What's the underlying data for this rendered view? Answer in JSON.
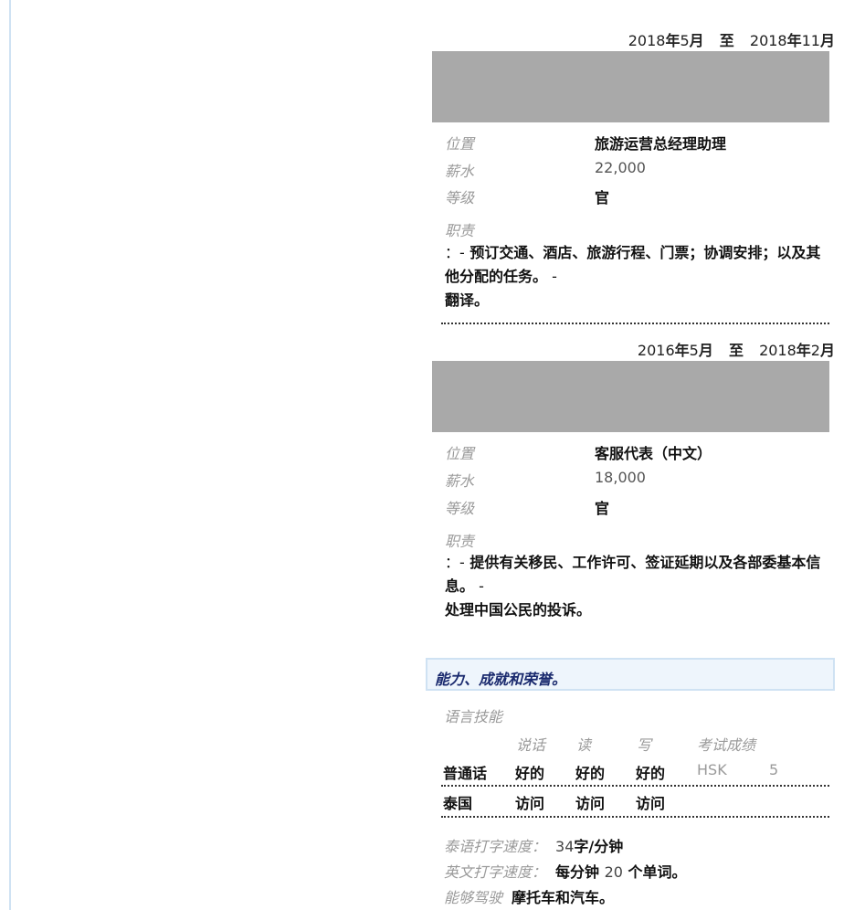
{
  "jobs": [
    {
      "date": {
        "start_year": "2018",
        "start_month": "5",
        "sep": "至",
        "end_year": "2018",
        "end_month": "11",
        "year_char": "年",
        "month_char": "月"
      },
      "position_label": "位置",
      "position": "旅游运营总经理助理",
      "salary_label": "薪水",
      "salary": "22,000",
      "level_label": "等级",
      "level": "官",
      "duty_label": "职责",
      "duty_lead": "：-",
      "duty_line1": " 预订交通、酒店、旅游行程、门票；协调安排；以及其他分配的任务。",
      "duty_dash": " -",
      "duty_line2": "翻译。"
    },
    {
      "date": {
        "start_year": "2016",
        "start_month": "5",
        "sep": "至",
        "end_year": "2018",
        "end_month": "2",
        "year_char": "年",
        "month_char": "月"
      },
      "position_label": "位置",
      "position": "客服代表（中文）",
      "salary_label": "薪水",
      "salary": "18,000",
      "level_label": "等级",
      "level": "官",
      "duty_label": "职责",
      "duty_lead": "：-",
      "duty_line1": " 提供有关移民、工作许可、签证延期以及各部委基本信息。",
      "duty_dash": " -",
      "duty_line2": "处理中国公民的投诉。"
    }
  ],
  "skills": {
    "section_title": "能力、成就和荣誉。",
    "language_label": "语言技能",
    "headers": [
      "说话",
      "读",
      "写",
      "考试成绩"
    ],
    "rows": [
      {
        "lang": "普通话",
        "speak": "好的",
        "read": "好的",
        "write": "好的",
        "exam": "HSK",
        "score": "5"
      },
      {
        "lang": "泰国",
        "speak": "访问",
        "read": "访问",
        "write": "访问",
        "exam": "",
        "score": ""
      }
    ],
    "thai_typing_label": "泰语打字速度：",
    "thai_typing_num": "34",
    "thai_typing_unit": "字/分钟",
    "en_typing_label": "英文打字速度：",
    "en_typing_pre": "每分钟",
    "en_typing_num": "20",
    "en_typing_post": "个单词。",
    "driving_label": "能够驾驶",
    "driving_value": "摩托车和汽车。"
  }
}
